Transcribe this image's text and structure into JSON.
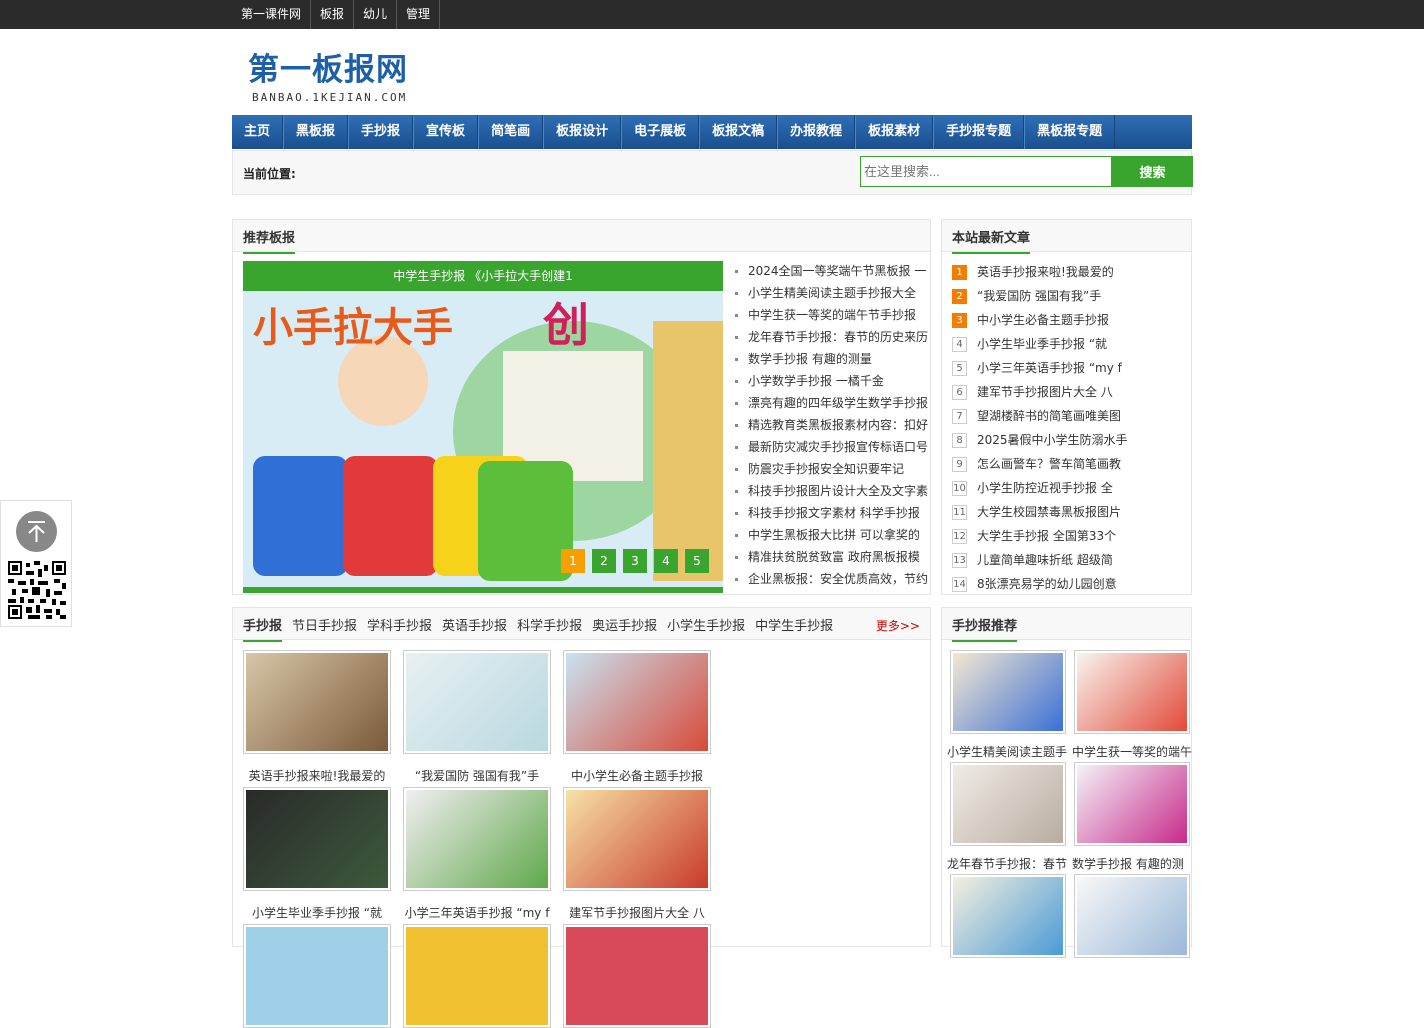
{
  "topnav": [
    "第一课件网",
    "板报",
    "幼儿",
    "管理"
  ],
  "logo": {
    "title": "第一板报网",
    "sub": "BANBAO.1KEJIAN.COM"
  },
  "mainnav": [
    "主页",
    "黑板报",
    "手抄报",
    "宣传板",
    "简笔画",
    "板报设计",
    "电子展板",
    "板报文稿",
    "办报教程",
    "板报素材",
    "手抄报专题",
    "黑板报专题"
  ],
  "crumb": {
    "label": "当前位置:"
  },
  "search": {
    "placeholder": "在这里搜索...",
    "button": "搜索"
  },
  "recommend": {
    "title": "推荐板报",
    "slide_caption": "中学生手抄报 《小手拉大手创建1",
    "dots": [
      "1",
      "2",
      "3",
      "4",
      "5"
    ],
    "items": [
      "2024全国一等奖端午节黑板报 一",
      "小学生精美阅读主题手抄报大全",
      "中学生获一等奖的端午节手抄报",
      "龙年春节手抄报：春节的历史来历",
      "数学手抄报 有趣的测量",
      "小学数学手抄报 一橘千金",
      "漂亮有趣的四年级学生数学手抄报",
      "精选教育类黑板报素材内容：扣好",
      "最新防灾减灾手抄报宣传标语口号",
      "防震灾手抄报安全知识要牢记",
      "科技手抄报图片设计大全及文字素",
      "科技手抄报文字素材 科学手抄报",
      "中学生黑板报大比拼 可以拿奖的",
      "精准扶贫脱贫致富 政府黑板报模",
      "企业黑板报：安全优质高效，节约"
    ]
  },
  "latest": {
    "title": "本站最新文章",
    "items": [
      "英语手抄报来啦!我最爱的",
      "“我爱国防 强国有我”手",
      "中小学生必备主题手抄报",
      "小学生毕业季手抄报 “就",
      "小学三年英语手抄报 “my f",
      "建军节手抄报图片大全 八",
      "望湖楼醉书的简笔画唯美图",
      "2025暑假中小学生防溺水手",
      "怎么画警车？警车简笔画教",
      "小学生防控近视手抄报 全",
      "大学生校园禁毒黑板报图片",
      "大学生手抄报 全国第33个",
      "儿童简单趣味折纸 超级简",
      "8张漂亮易学的幼儿园创意"
    ],
    "nums": [
      "1",
      "2",
      "3",
      "4",
      "5",
      "6",
      "7",
      "8",
      "9",
      "10",
      "11",
      "12",
      "13",
      "14"
    ]
  },
  "handcopy": {
    "tabs": [
      "手抄报",
      "节日手抄报",
      "学科手抄报",
      "英语手抄报",
      "科学手抄报",
      "奥运手抄报",
      "小学生手抄报",
      "中学生手抄报"
    ],
    "more": "更多>>",
    "captions": [
      "英语手抄报来啦!我最爱的",
      "“我爱国防 强国有我”手",
      "中小学生必备主题手抄报",
      "小学生毕业季手抄报 “就",
      "小学三年英语手抄报 “my f",
      "建军节手抄报图片大全 八"
    ]
  },
  "hcrec": {
    "title": "手抄报推荐",
    "captions": [
      "小学生精美阅读主题手",
      "中学生获一等奖的端午",
      "龙年春节手抄报：春节",
      "数学手抄报 有趣的测"
    ]
  }
}
